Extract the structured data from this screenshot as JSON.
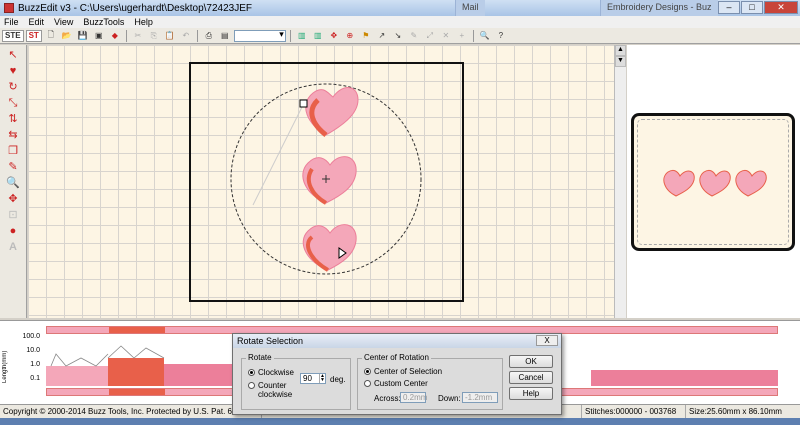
{
  "window": {
    "title": "BuzzEdit v3 - C:\\Users\\ugerhardt\\Desktop\\72423JEF",
    "bg_tabs": [
      "Mail",
      "Embroidery Designs - Buz"
    ]
  },
  "menu": [
    "File",
    "Edit",
    "View",
    "BuzzTools",
    "Help"
  ],
  "toolbar": {
    "stitch_label": "STE",
    "st_label": "ST",
    "icons": [
      "new-icon",
      "open-icon",
      "save-icon",
      "print-preview-icon",
      "cut-icon",
      "copy-icon",
      "paste-icon",
      "undo-icon",
      "redo-icon",
      "print-icon",
      "hoop-icon",
      "color-bars-icon",
      "select-icon",
      "center-icon",
      "flag-icon",
      "zoom-icon",
      "help-icon"
    ],
    "combo_value": ""
  },
  "left_tools": [
    "select-tool-icon",
    "heart-tool-icon",
    "rotate-tool-icon",
    "resize-tool-icon",
    "flip-tool-icon",
    "mirror-tool-icon",
    "duplicate-tool-icon",
    "stitch-tool-icon",
    "zoom-tool-icon",
    "move-tool-icon",
    "crop-tool-icon",
    "color-tool-icon",
    "text-tool-icon"
  ],
  "graph": {
    "ylabel": "Length(mm)",
    "yticks": [
      "100.0",
      "10.0",
      "1.0",
      "0.1"
    ]
  },
  "dialog": {
    "title": "Rotate Selection",
    "close_label": "X",
    "rotate_group": "Rotate",
    "clockwise_label": "Clockwise",
    "counter_label": "Counter clockwise",
    "degrees_value": "90",
    "deg_label": "deg.",
    "center_group": "Center of Rotation",
    "center_selection_label": "Center of Selection",
    "custom_center_label": "Custom Center",
    "across_label": "Across:",
    "across_value": "0.2mm",
    "down_label": "Down:",
    "down_value": "-1.2mm",
    "ok_label": "OK",
    "cancel_label": "Cancel",
    "help_label": "Help"
  },
  "status": {
    "copyright": "Copyright © 2000-2014 Buzz Tools, Inc. Protected by U.S. Pat. 6,167,823 B1; 6,5",
    "stitches": "Stitches:000000 - 003768",
    "size": "Size:25.60mm x 86.10mm"
  },
  "colors": {
    "heart_light": "#f4a7b9",
    "heart_mid": "#ec7f9a",
    "heart_dark": "#e8604a",
    "canvas_bg": "#fdf5e4"
  }
}
